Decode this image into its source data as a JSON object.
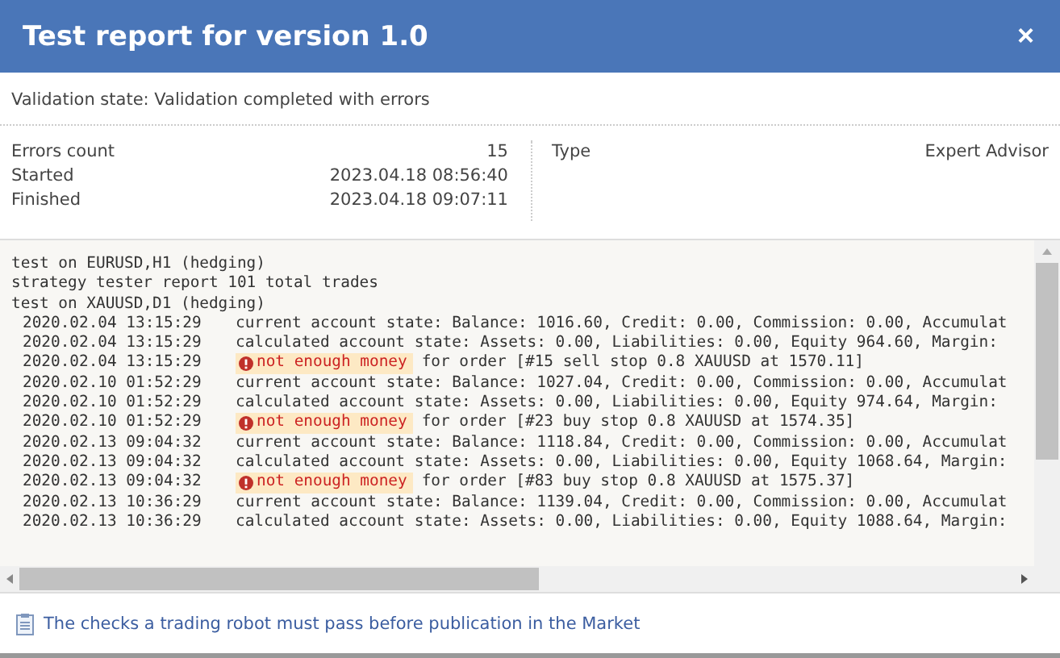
{
  "window": {
    "title": "Test report for version 1.0",
    "close": "×"
  },
  "validation_state": "Validation state: Validation completed with errors",
  "info_left": [
    {
      "label": "Errors count",
      "value": "15"
    },
    {
      "label": "Started",
      "value": "2023.04.18 08:56:40"
    },
    {
      "label": "Finished",
      "value": "2023.04.18 09:07:11"
    }
  ],
  "info_right": [
    {
      "label": "Type",
      "value": "Expert Advisor"
    }
  ],
  "log": [
    {
      "kind": "header",
      "text": "test on EURUSD,H1 (hedging)"
    },
    {
      "kind": "header",
      "text": "strategy tester report 101 total trades"
    },
    {
      "kind": "header",
      "text": "test on XAUUSD,D1 (hedging)"
    },
    {
      "kind": "info",
      "time": "2020.02.04 13:15:29",
      "text": "current account state: Balance: 1016.60, Credit: 0.00, Commission: 0.00, Accumulat"
    },
    {
      "kind": "info",
      "time": "2020.02.04 13:15:29",
      "text": "calculated account state: Assets: 0.00, Liabilities: 0.00, Equity 964.60, Margin:"
    },
    {
      "kind": "error",
      "time": "2020.02.04 13:15:29",
      "badge": "not enough money",
      "text": "for order [#15 sell stop 0.8 XAUUSD at 1570.11]"
    },
    {
      "kind": "info",
      "time": "2020.02.10 01:52:29",
      "text": "current account state: Balance: 1027.04, Credit: 0.00, Commission: 0.00, Accumulat"
    },
    {
      "kind": "info",
      "time": "2020.02.10 01:52:29",
      "text": "calculated account state: Assets: 0.00, Liabilities: 0.00, Equity 974.64, Margin:"
    },
    {
      "kind": "error",
      "time": "2020.02.10 01:52:29",
      "badge": "not enough money",
      "text": "for order [#23 buy stop 0.8 XAUUSD at 1574.35]"
    },
    {
      "kind": "info",
      "time": "2020.02.13 09:04:32",
      "text": "current account state: Balance: 1118.84, Credit: 0.00, Commission: 0.00, Accumulat"
    },
    {
      "kind": "info",
      "time": "2020.02.13 09:04:32",
      "text": "calculated account state: Assets: 0.00, Liabilities: 0.00, Equity 1068.64, Margin:"
    },
    {
      "kind": "error",
      "time": "2020.02.13 09:04:32",
      "badge": "not enough money",
      "text": "for order [#83 buy stop 0.8 XAUUSD at 1575.37]"
    },
    {
      "kind": "info",
      "time": "2020.02.13 10:36:29",
      "text": "current account state: Balance: 1139.04, Credit: 0.00, Commission: 0.00, Accumulat"
    },
    {
      "kind": "info",
      "time": "2020.02.13 10:36:29",
      "text": "calculated account state: Assets: 0.00, Liabilities: 0.00, Equity 1088.64, Margin:"
    }
  ],
  "link": "The checks a trading robot must pass before publication in the Market"
}
